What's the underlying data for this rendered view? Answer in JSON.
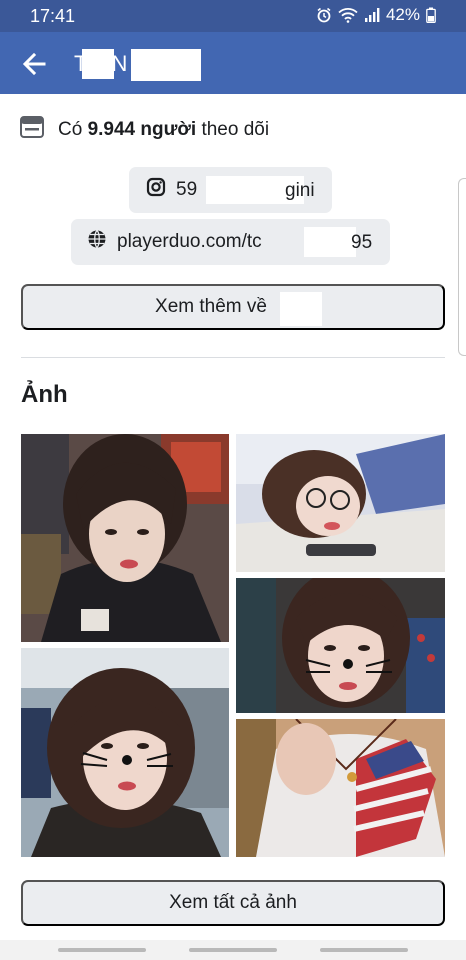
{
  "status_bar": {
    "time": "17:41",
    "battery": "42%",
    "icons": [
      "alarm-icon",
      "wifi-icon",
      "signal-icon",
      "battery-icon"
    ]
  },
  "header": {
    "title": "T    N",
    "back_icon": "arrow-left-icon",
    "background": "#4267b2"
  },
  "profile": {
    "followers_prefix": "Có ",
    "followers_count": "9.944 người",
    "followers_suffix": " theo dõi",
    "instagram_left": "59",
    "instagram_right": "gini",
    "website_left": "playerduo.com/tc",
    "website_right": "95"
  },
  "buttons": {
    "see_more": "Xem thêm về",
    "see_all_photos": "Xem tất cả ảnh"
  },
  "photos": {
    "section_title": "Ảnh",
    "count": 5
  }
}
